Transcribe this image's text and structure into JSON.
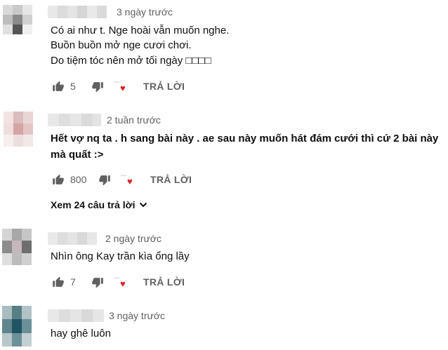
{
  "comments": [
    {
      "time": "3 ngày trước",
      "lines": [
        "Có ai như t. Nge hoài vẫn muốn nghe.",
        "Buồn buồn mở nge cươi chơi.",
        "Do tiệm tóc nên mở tối ngày □□□□"
      ],
      "likes": "5",
      "reply_label": "TRẢ LỜI"
    },
    {
      "time": "2 tuần trước",
      "lines": [
        "Hết vợ nq ta . h sang bài này . ae sau này muốn hát đám cưới thì cứ 2 bài này",
        "mà quất :>"
      ],
      "likes": "800",
      "reply_label": "TRẢ LỜI",
      "view_replies": "Xem 24 câu trả lời"
    },
    {
      "time": "2 ngày trước",
      "lines": [
        "Nhìn ông Kay trần kìa ổng lầy"
      ],
      "likes": "7",
      "reply_label": "TRẢ LỜI"
    },
    {
      "time": "3 ngày trước",
      "lines": [
        "hay ghê luôn"
      ]
    }
  ],
  "icons": {
    "like": "thumb-up-icon",
    "dislike": "thumb-down-icon",
    "creator_heart": "creator-heart-icon",
    "expand": "chevron-down-icon"
  },
  "colors": {
    "heart": "#e02020",
    "meta_text": "#606060"
  }
}
